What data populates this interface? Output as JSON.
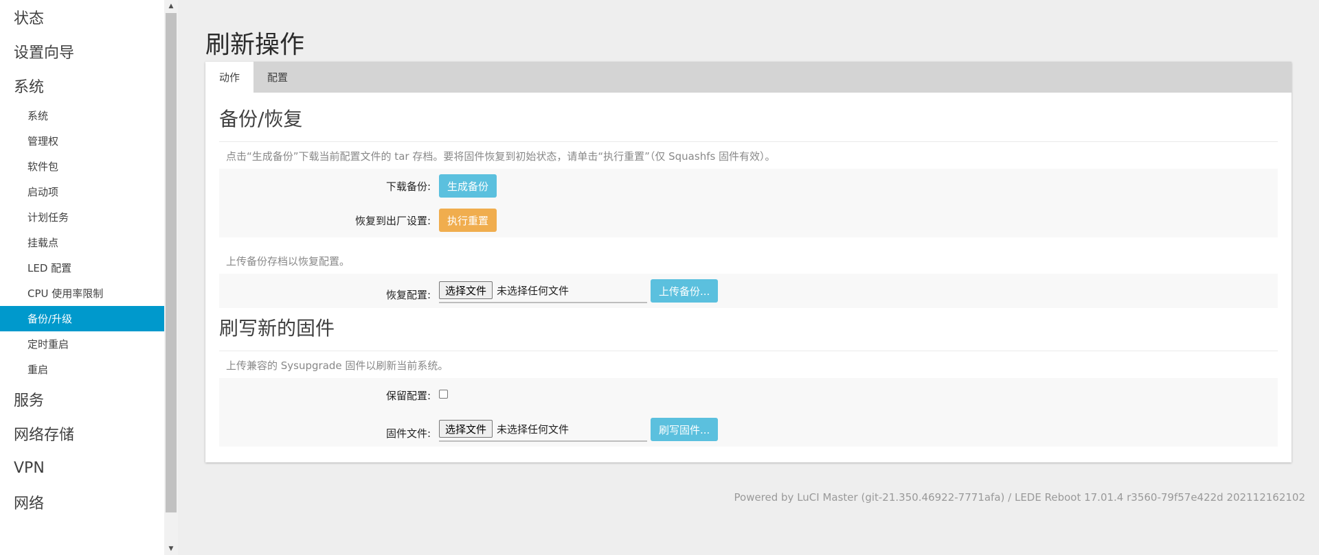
{
  "sidebar": {
    "items": [
      {
        "label": "状态"
      },
      {
        "label": "设置向导"
      },
      {
        "label": "系统"
      }
    ],
    "system_sub": [
      {
        "label": "系统"
      },
      {
        "label": "管理权"
      },
      {
        "label": "软件包"
      },
      {
        "label": "启动项"
      },
      {
        "label": "计划任务"
      },
      {
        "label": "挂载点"
      },
      {
        "label": "LED 配置"
      },
      {
        "label": "CPU 使用率限制"
      },
      {
        "label": "备份/升级",
        "active": true
      },
      {
        "label": "定时重启"
      },
      {
        "label": "重启"
      }
    ],
    "items_after": [
      {
        "label": "服务"
      },
      {
        "label": "网络存储"
      },
      {
        "label": "VPN"
      },
      {
        "label": "网络"
      }
    ]
  },
  "page": {
    "title": "刷新操作"
  },
  "tabs": [
    {
      "label": "动作",
      "active": true
    },
    {
      "label": "配置"
    }
  ],
  "backup": {
    "title": "备份/恢复",
    "desc": "点击“生成备份”下载当前配置文件的 tar 存档。要将固件恢复到初始状态，请单击“执行重置”（仅 Squashfs 固件有效）。",
    "download_label": "下载备份:",
    "generate_btn": "生成备份",
    "reset_label": "恢复到出厂设置:",
    "reset_btn": "执行重置",
    "upload_desc": "上传备份存档以恢复配置。",
    "restore_label": "恢复配置:",
    "choose_file": "选择文件",
    "no_file": "未选择任何文件",
    "upload_btn": "上传备份..."
  },
  "flash": {
    "title": "刷写新的固件",
    "desc": "上传兼容的 Sysupgrade 固件以刷新当前系统。",
    "keep_label": "保留配置:",
    "keep_checked": false,
    "firmware_label": "固件文件:",
    "choose_file": "选择文件",
    "no_file": "未选择任何文件",
    "flash_btn": "刷写固件..."
  },
  "footer": "Powered by LuCI Master (git-21.350.46922-7771afa) / LEDE Reboot 17.01.4 r3560-79f57e422d 202112162102",
  "colors": {
    "accent": "#0099cc",
    "info": "#5bc0de",
    "warning": "#f0ad4e"
  }
}
